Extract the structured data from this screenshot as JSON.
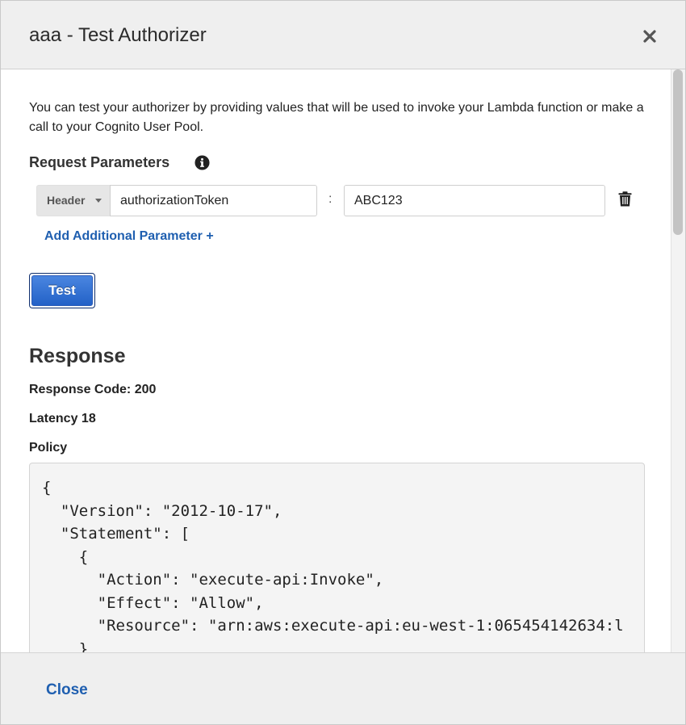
{
  "dialog": {
    "title": "aaa - Test Authorizer",
    "close_icon": "close-icon"
  },
  "intro": {
    "text": "You can test your authorizer by providing values that will be used to invoke your Lambda function or make a call to your Cognito User Pool."
  },
  "request_parameters": {
    "label": "Request Parameters",
    "info_icon": "info-icon",
    "rows": [
      {
        "type": "Header",
        "name": "authorizationToken",
        "separator": ":",
        "value": "ABC123",
        "delete_icon": "trash-icon"
      }
    ],
    "add_label": "Add Additional Parameter +"
  },
  "test_button": {
    "label": "Test"
  },
  "response": {
    "heading": "Response",
    "code_text": "Response Code: 200",
    "latency_text": "Latency 18",
    "policy_label": "Policy",
    "policy_json": "{\n  \"Version\": \"2012-10-17\",\n  \"Statement\": [\n    {\n      \"Action\": \"execute-api:Invoke\",\n      \"Effect\": \"Allow\",\n      \"Resource\": \"arn:aws:execute-api:eu-west-1:065454142634:l\n    }"
  },
  "footer": {
    "close_label": "Close"
  },
  "colors": {
    "accent": "#1f5fb0",
    "button_blue": "#2361c7",
    "header_bg": "#efefef",
    "code_bg": "#f4f4f4"
  }
}
